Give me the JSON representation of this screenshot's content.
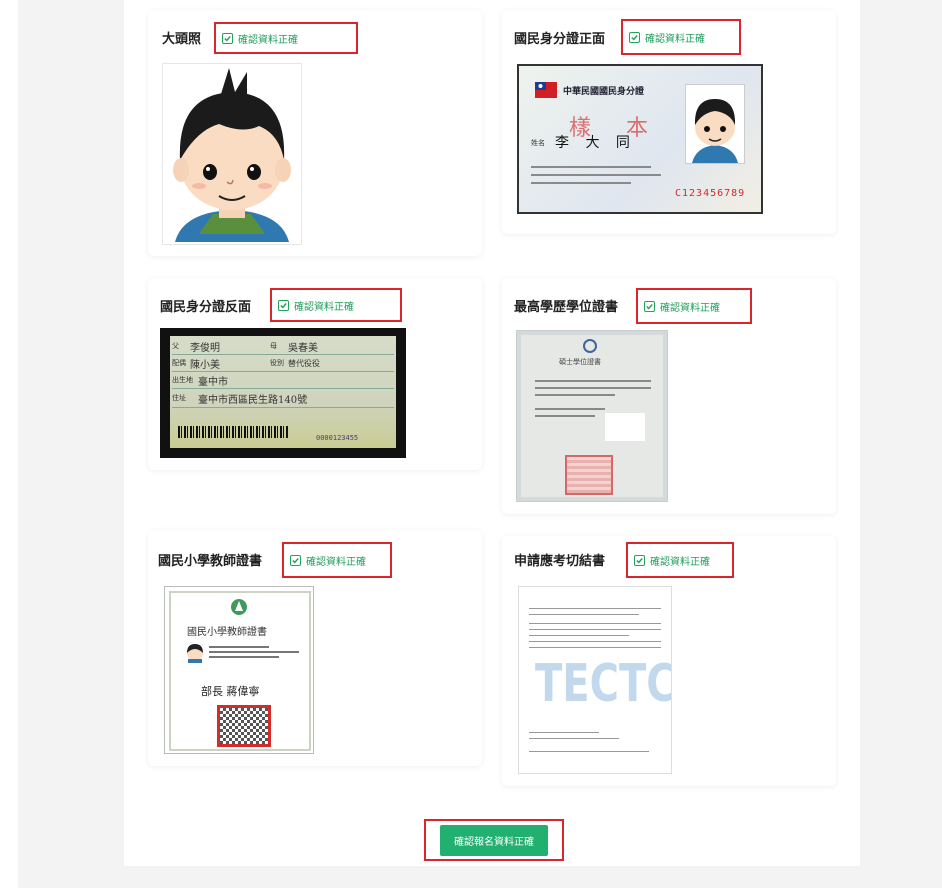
{
  "cards": [
    {
      "title": "大頭照",
      "confirm_label": "確認資料正確"
    },
    {
      "title": "國民身分證正面",
      "confirm_label": "確認資料正確"
    },
    {
      "title": "國民身分證反面",
      "confirm_label": "確認資料正確"
    },
    {
      "title": "最高學歷學位證書",
      "confirm_label": "確認資料正確"
    },
    {
      "title": "國民小學教師證書",
      "confirm_label": "確認資料正確"
    },
    {
      "title": "申請應考切結書",
      "confirm_label": "確認資料正確"
    }
  ],
  "id_front": {
    "header": "中華民國國民身分證",
    "watermark": "樣 本",
    "name_label": "姓名",
    "name": "李 大 同",
    "number": "C123456789"
  },
  "id_back": {
    "father_label": "父",
    "father": "李俊明",
    "mother_label": "母",
    "mother": "吳春美",
    "spouse_label": "配偶",
    "spouse": "陳小美",
    "military_label": "役別",
    "military": "替代役役",
    "birthplace_label": "出生地",
    "birthplace": "臺中市",
    "address_label": "住址",
    "address": "臺中市西區民生路140號",
    "serial": "0000123455"
  },
  "diploma": {
    "title": "碩士學位證書"
  },
  "teacher_cert": {
    "title": "國民小學教師證書",
    "signature": "部長 蔣偉寧"
  },
  "affidavit": {
    "watermark": "TECTC"
  },
  "submit": {
    "label": "確認報名資料正確"
  },
  "colors": {
    "confirm_border": "#d8262c",
    "confirm_text": "#1e9e5a",
    "submit_bg": "#22b070"
  }
}
